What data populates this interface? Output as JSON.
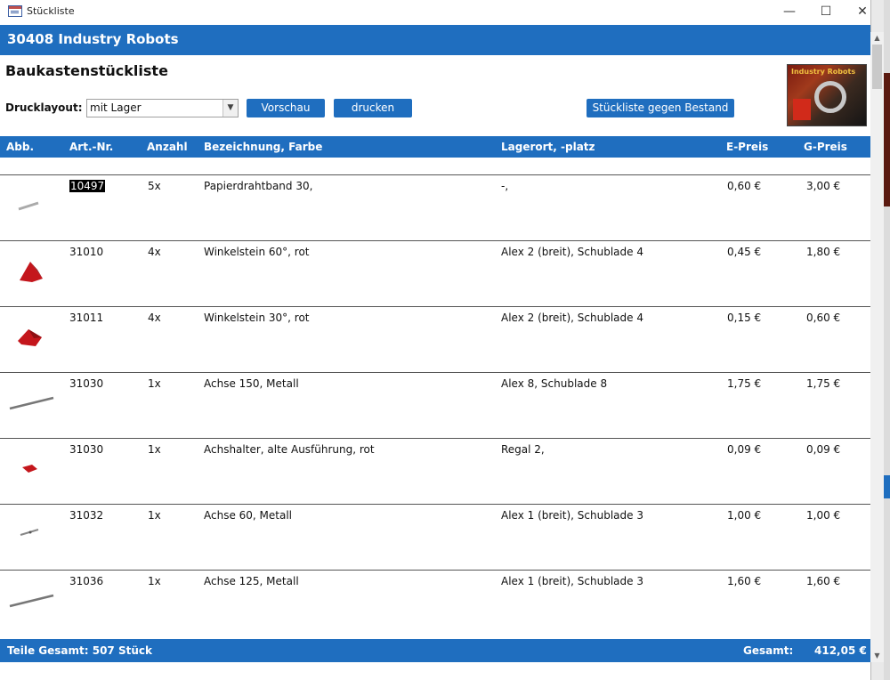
{
  "window": {
    "title": "Stückliste",
    "minimize": "—",
    "maximize": "☐",
    "close": "✕"
  },
  "header": {
    "title": "30408 Industry Robots"
  },
  "subtitle": "Baukastenstückliste",
  "controls": {
    "druck_label": "Drucklayout:",
    "druck_value": "mit Lager",
    "vorschau": "Vorschau",
    "drucken": "drucken",
    "bestand": "Stückliste gegen Bestand"
  },
  "thumbnail": {
    "text": "Industry Robots",
    "icon": "kit-box-image"
  },
  "columns": {
    "abb": "Abb.",
    "art": "Art.-Nr.",
    "anzahl": "Anzahl",
    "bez": "Bezeichnung, Farbe",
    "lager": "Lagerort, -platz",
    "epreis": "E-Preis",
    "gpreis": "G-Preis"
  },
  "rows": [
    {
      "art": "10497",
      "anzahl": "5x",
      "bez": "Papierdrahtband 30,",
      "lager": "-,",
      "epreis": "0,60 €",
      "gpreis": "3,00 €",
      "img": "wire-strip-icon"
    },
    {
      "art": "31010",
      "anzahl": "4x",
      "bez": "Winkelstein 60°, rot",
      "lager": "Alex 2 (breit), Schublade 4",
      "epreis": "0,45 €",
      "gpreis": "1,80 €",
      "img": "red-wedge-icon"
    },
    {
      "art": "31011",
      "anzahl": "4x",
      "bez": "Winkelstein 30°, rot",
      "lager": "Alex 2 (breit), Schublade 4",
      "epreis": "0,15 €",
      "gpreis": "0,60 €",
      "img": "red-wedge-icon"
    },
    {
      "art": "31030",
      "anzahl": "1x",
      "bez": "Achse 150, Metall",
      "lager": "Alex 8, Schublade 8",
      "epreis": "1,75 €",
      "gpreis": "1,75 €",
      "img": "axle-icon"
    },
    {
      "art": "31030",
      "anzahl": "1x",
      "bez": "Achshalter, alte Ausführung, rot",
      "lager": "Regal 2,",
      "epreis": "0,09 €",
      "gpreis": "0,09 €",
      "img": "red-holder-icon"
    },
    {
      "art": "31032",
      "anzahl": "1x",
      "bez": "Achse 60, Metall",
      "lager": "Alex 1 (breit), Schublade 3",
      "epreis": "1,00 €",
      "gpreis": "1,00 €",
      "img": "short-axle-icon"
    },
    {
      "art": "31036",
      "anzahl": "1x",
      "bez": "Achse 125, Metall",
      "lager": "Alex 1 (breit), Schublade 3",
      "epreis": "1,60 €",
      "gpreis": "1,60 €",
      "img": "axle-icon"
    }
  ],
  "footer": {
    "teile": "Teile Gesamt: 507 Stück",
    "gesamt_label": "Gesamt:",
    "gesamt_value": "412,05 €"
  },
  "scrollbar": {
    "up": "▲",
    "down": "▼"
  },
  "colors": {
    "accent": "#1f6ebf",
    "part_red": "#c4161c"
  }
}
